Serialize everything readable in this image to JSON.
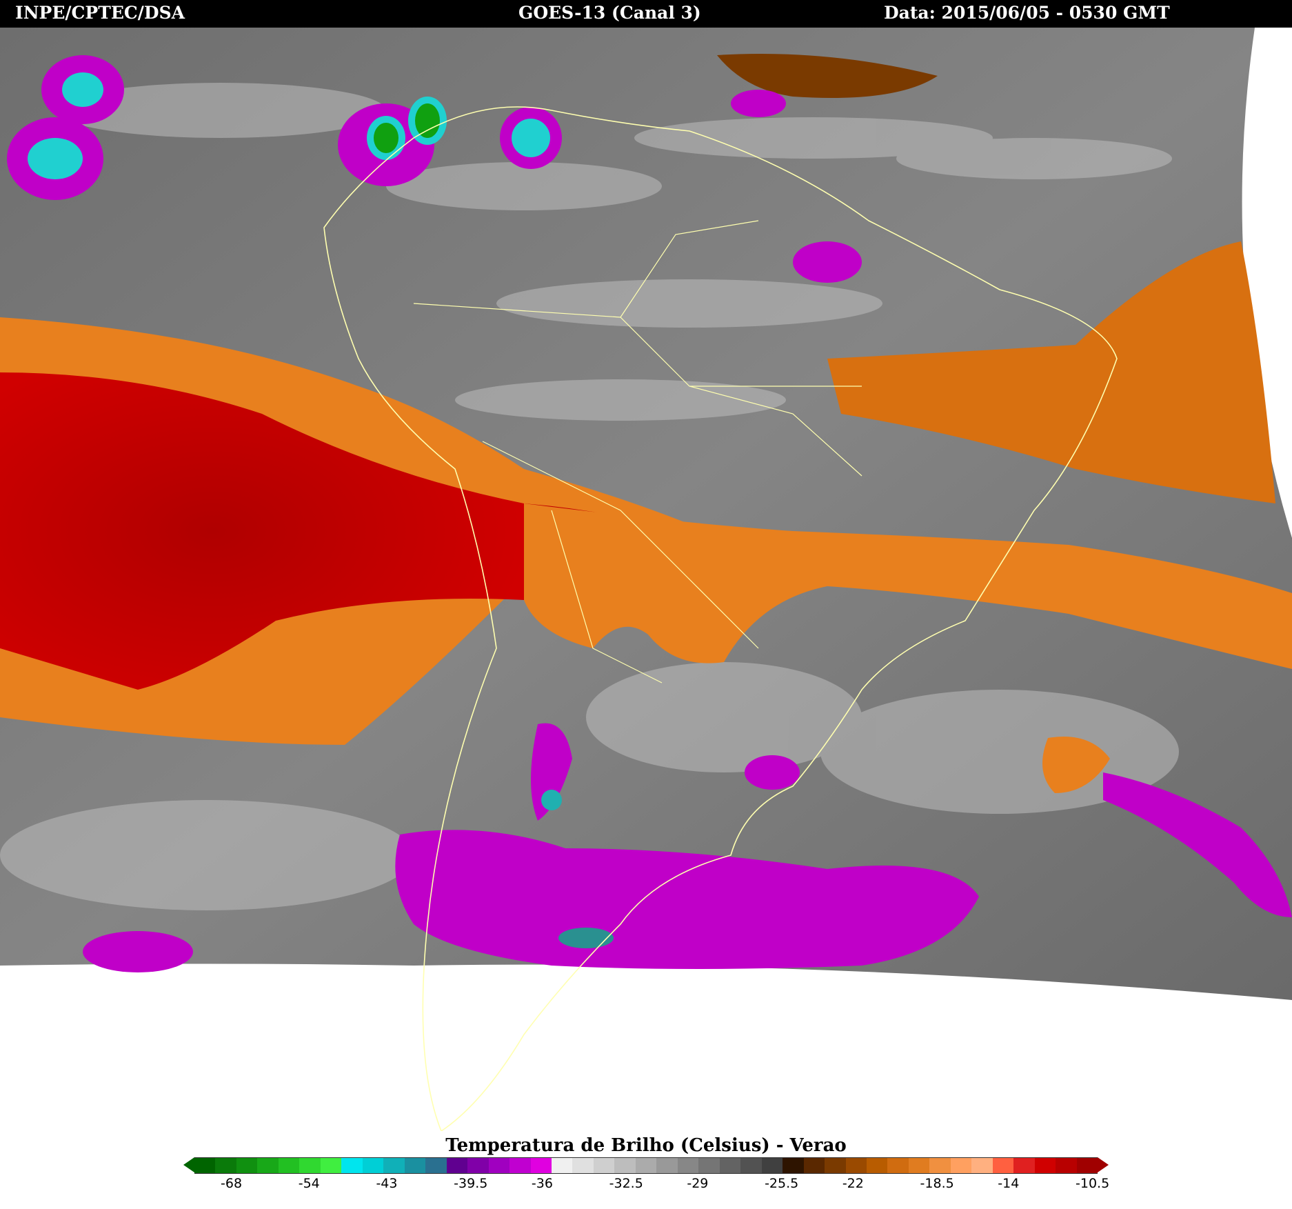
{
  "header": {
    "left": "INPE/CPTEC/DSA",
    "center": "GOES-13 (Canal 3)",
    "right": "Data: 2015/06/05 - 0530 GMT"
  },
  "legend": {
    "title": "Temperatura de Brilho (Celsius) - Verao",
    "ticks": [
      "-68",
      "-54",
      "-43",
      "-39.5",
      "-36",
      "-32.5",
      "-29",
      "-25.5",
      "-22",
      "-18.5",
      "-14",
      "-10.5"
    ],
    "colors": [
      "#006400",
      "#0a7a0a",
      "#109010",
      "#18a818",
      "#22c022",
      "#30d830",
      "#40ee40",
      "#00e5ee",
      "#00cfd6",
      "#10b0b8",
      "#1a90a0",
      "#2a7090",
      "#600090",
      "#8000a8",
      "#a000c0",
      "#c000d0",
      "#e000e0",
      "#f0f0f0",
      "#e0e0e0",
      "#cfcfcf",
      "#bdbdbd",
      "#ababab",
      "#999999",
      "#878787",
      "#757575",
      "#636363",
      "#525252",
      "#404040",
      "#2e1400",
      "#5a2800",
      "#7a3a00",
      "#9a4a00",
      "#b85c00",
      "#d06c10",
      "#e07c20",
      "#f09040",
      "#ffa060",
      "#ffb080",
      "#ff6040",
      "#e02020",
      "#d00000",
      "#b80000",
      "#a00000"
    ]
  },
  "map": {
    "region": "South America",
    "land_outline_color": "#ffffb0",
    "palette": {
      "red_cold_band": "#c00000",
      "orange_band": "#e8801e",
      "magenta_cloud": "#c000c8",
      "green_core": "#10a010",
      "cyan_core": "#20d0d0",
      "gray_background": "#7a7a7a"
    }
  }
}
